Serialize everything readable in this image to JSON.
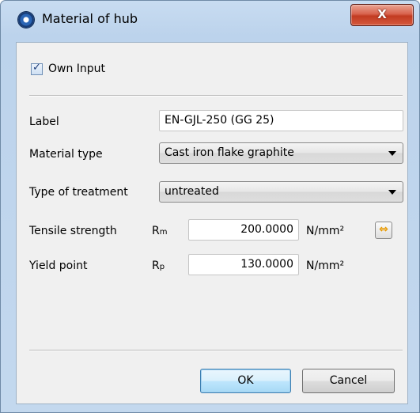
{
  "window": {
    "title": "Material of hub",
    "close_glyph": "X"
  },
  "icons": {
    "app": "gear-wheel-icon",
    "close": "close-icon",
    "swap": "swap-arrows-icon",
    "dropdown": "chevron-down-icon",
    "check": "checkmark-icon"
  },
  "own_input": {
    "label": "Own Input",
    "checked": true
  },
  "label_field": {
    "label": "Label",
    "value": "EN-GJL-250 (GG 25)"
  },
  "material_type": {
    "label": "Material type",
    "value": "Cast iron flake graphite"
  },
  "treatment": {
    "label": "Type of treatment",
    "value": "untreated"
  },
  "tensile": {
    "label": "Tensile strength",
    "symbol": "R",
    "subscript": "m",
    "value": "200.0000",
    "unit": "N/mm²"
  },
  "yield": {
    "label": "Yield point",
    "symbol": "R",
    "subscript": "p",
    "value": "130.0000",
    "unit": "N/mm²"
  },
  "buttons": {
    "ok": "OK",
    "cancel": "Cancel"
  },
  "colors": {
    "title_bar": "#c3d8ee",
    "close_button": "#c94a30",
    "client_bg": "#f0f0f0",
    "swap_arrow": "#e89a00"
  }
}
